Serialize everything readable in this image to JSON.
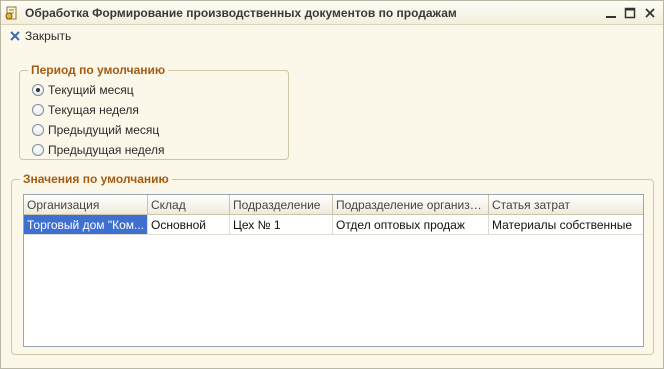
{
  "window": {
    "title": "Обработка  Формирование производственных документов по продажам",
    "minimize_icon": "minimize-icon",
    "maximize_icon": "maximize-icon",
    "close_icon": "close-icon"
  },
  "toolbar": {
    "close_label": "Закрыть"
  },
  "period_group": {
    "title": "Период по умолчанию",
    "options": [
      {
        "label": "Текущий месяц",
        "checked": true
      },
      {
        "label": "Текущая неделя",
        "checked": false
      },
      {
        "label": "Предыдущий месяц",
        "checked": false
      },
      {
        "label": "Предыдущая неделя",
        "checked": false
      }
    ]
  },
  "defaults_group": {
    "title": "Значения по умолчанию",
    "columns": [
      "Организация",
      "Склад",
      "Подразделение",
      "Подразделение организации",
      "Статья затрат"
    ],
    "rows": [
      [
        "Торговый дом \"Ком...",
        "Основной",
        "Цех № 1",
        "Отдел оптовых продаж",
        "Материалы собственные"
      ]
    ]
  },
  "colors": {
    "group_title": "#a55b12",
    "selection": "#3f6fd0",
    "window_bg": "#fbf8ea"
  }
}
